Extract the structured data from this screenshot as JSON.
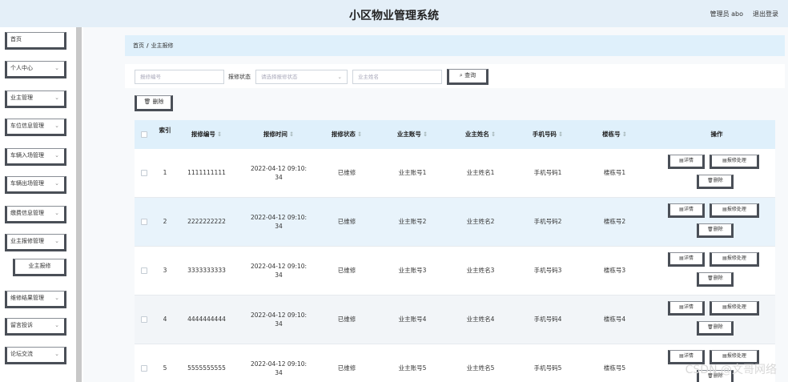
{
  "header": {
    "title": "小区物业管理系统",
    "admin_label": "管理员 abo",
    "logout_label": "退出登录"
  },
  "sidebar": {
    "items": [
      {
        "label": "首页",
        "has_arrow": false
      },
      {
        "label": "个人中心",
        "has_arrow": true
      },
      {
        "label": "业主管理",
        "has_arrow": true
      },
      {
        "label": "车位信息管理",
        "has_arrow": true
      },
      {
        "label": "车辆入场管理",
        "has_arrow": true
      },
      {
        "label": "车辆出场管理",
        "has_arrow": true
      },
      {
        "label": "缴费信息管理",
        "has_arrow": true
      },
      {
        "label": "业主报修管理",
        "has_arrow": true
      },
      {
        "label": "业主报修",
        "has_arrow": false,
        "sub": true
      },
      {
        "label": "维修结果管理",
        "has_arrow": true
      },
      {
        "label": "留言投诉",
        "has_arrow": true
      },
      {
        "label": "论坛交流",
        "has_arrow": true
      }
    ],
    "chevron": "⌄"
  },
  "breadcrumb": {
    "home": "首页",
    "sep": "/",
    "current": "业主报修"
  },
  "search": {
    "repair_no_placeholder": "报修编号",
    "status_label": "报修状态",
    "status_placeholder": "请选择报修状态",
    "owner_name_placeholder": "业主姓名",
    "query_label": "查询",
    "search_glyph": "⌕"
  },
  "toolbar": {
    "delete_label": "删除",
    "trash_glyph": "🗑"
  },
  "table": {
    "headers": {
      "index": "索引",
      "repair_no": "报修编号",
      "repair_time": "报修时间",
      "status": "报修状态",
      "owner_account": "业主账号",
      "owner_name": "业主姓名",
      "phone": "手机号码",
      "building": "楼栋号",
      "actions": "操作"
    },
    "sort_glyph": "⇕",
    "rows": [
      {
        "index": "1",
        "repair_no": "1111111111",
        "time_line1": "2022-04-12 09:10:",
        "time_line2": "34",
        "status": "已维修",
        "owner_account": "业主账号1",
        "owner_name": "业主姓名1",
        "phone": "手机号码1",
        "building": "楼栋号1"
      },
      {
        "index": "2",
        "repair_no": "2222222222",
        "time_line1": "2022-04-12 09:10:",
        "time_line2": "34",
        "status": "已维修",
        "owner_account": "业主账号2",
        "owner_name": "业主姓名2",
        "phone": "手机号码2",
        "building": "楼栋号2"
      },
      {
        "index": "3",
        "repair_no": "3333333333",
        "time_line1": "2022-04-12 09:10:",
        "time_line2": "34",
        "status": "已维修",
        "owner_account": "业主账号3",
        "owner_name": "业主姓名3",
        "phone": "手机号码3",
        "building": "楼栋号3"
      },
      {
        "index": "4",
        "repair_no": "4444444444",
        "time_line1": "2022-04-12 09:10:",
        "time_line2": "34",
        "status": "已维修",
        "owner_account": "业主账号4",
        "owner_name": "业主姓名4",
        "phone": "手机号码4",
        "building": "楼栋号4"
      },
      {
        "index": "5",
        "repair_no": "5555555555",
        "time_line1": "2022-04-12 09:10:",
        "time_line2": "34",
        "status": "已维修",
        "owner_account": "业主账号5",
        "owner_name": "业主姓名5",
        "phone": "手机号码5",
        "building": "楼栋号5"
      }
    ],
    "actions": {
      "detail": "详情",
      "handle": "报修处理",
      "delete": "删除",
      "doc_glyph": "▤",
      "trash_glyph": "🗑"
    }
  },
  "watermark": "CSDN @文哥网络"
}
